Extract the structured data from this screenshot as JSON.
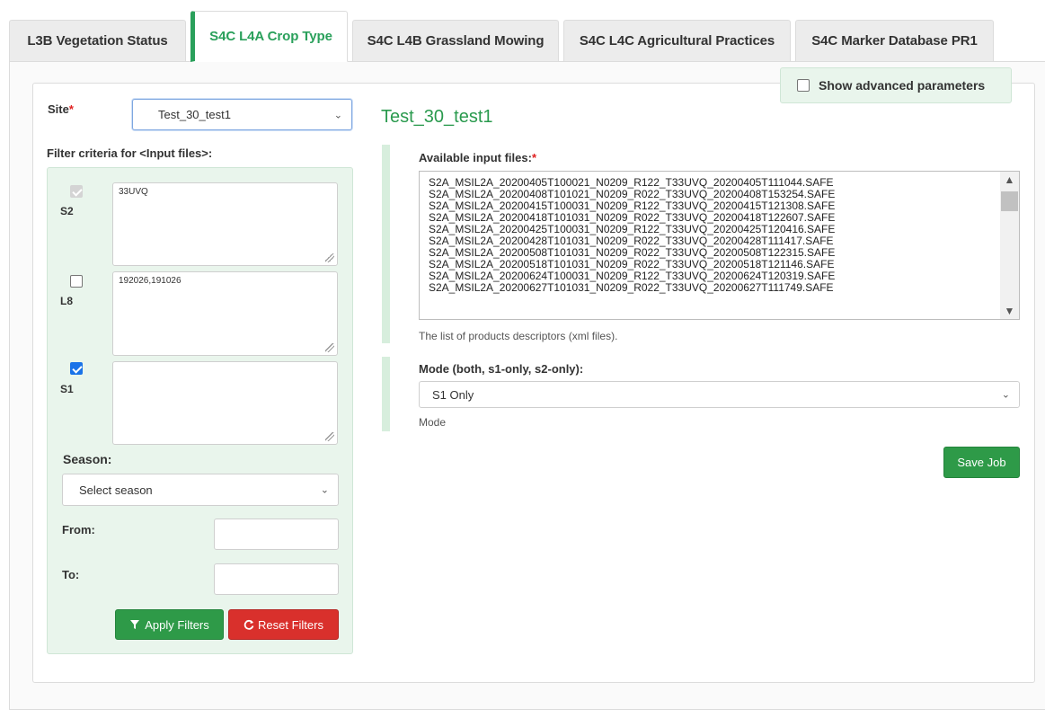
{
  "tabs": [
    {
      "label": "L3B Vegetation Status"
    },
    {
      "label": "S4C L4A Crop Type"
    },
    {
      "label": "S4C L4B Grassland Mowing"
    },
    {
      "label": "S4C L4C Agricultural Practices"
    },
    {
      "label": "S4C Marker Database PR1"
    }
  ],
  "advanced": {
    "label": "Show advanced parameters"
  },
  "site": {
    "label": "Site",
    "required_mark": "*",
    "value": "Test_30_test1"
  },
  "filters": {
    "title": "Filter criteria for <Input files>:",
    "s2": {
      "label": "S2",
      "value": "33UVQ"
    },
    "l8": {
      "label": "L8",
      "value": "192026,191026"
    },
    "s1": {
      "label": "S1",
      "value": ""
    },
    "season": {
      "label": "Season:",
      "value": "Select season"
    },
    "from": {
      "label": "From:",
      "value": ""
    },
    "to": {
      "label": "To:",
      "value": ""
    },
    "apply_label": "Apply Filters",
    "reset_label": "Reset Filters"
  },
  "main": {
    "site_title": "Test_30_test1",
    "files_label": "Available input files:",
    "files_required_mark": "*",
    "files": [
      "S2A_MSIL2A_20200405T100021_N0209_R122_T33UVQ_20200405T111044.SAFE",
      "S2A_MSIL2A_20200408T101021_N0209_R022_T33UVQ_20200408T153254.SAFE",
      "S2A_MSIL2A_20200415T100031_N0209_R122_T33UVQ_20200415T121308.SAFE",
      "S2A_MSIL2A_20200418T101031_N0209_R022_T33UVQ_20200418T122607.SAFE",
      "S2A_MSIL2A_20200425T100031_N0209_R122_T33UVQ_20200425T120416.SAFE",
      "S2A_MSIL2A_20200428T101031_N0209_R022_T33UVQ_20200428T111417.SAFE",
      "S2A_MSIL2A_20200508T101031_N0209_R022_T33UVQ_20200508T122315.SAFE",
      "S2A_MSIL2A_20200518T101031_N0209_R022_T33UVQ_20200518T121146.SAFE",
      "S2A_MSIL2A_20200624T100031_N0209_R122_T33UVQ_20200624T120319.SAFE",
      "S2A_MSIL2A_20200627T101031_N0209_R022_T33UVQ_20200627T111749.SAFE"
    ],
    "files_help": "The list of products descriptors (xml files).",
    "mode_label": "Mode (both, s1-only, s2-only):",
    "mode_value": "S1 Only",
    "mode_help": "Mode",
    "save_label": "Save Job"
  },
  "colors": {
    "accent": "#2aa05b",
    "danger": "#d9302c",
    "panel_bg": "#e9f5ec"
  }
}
